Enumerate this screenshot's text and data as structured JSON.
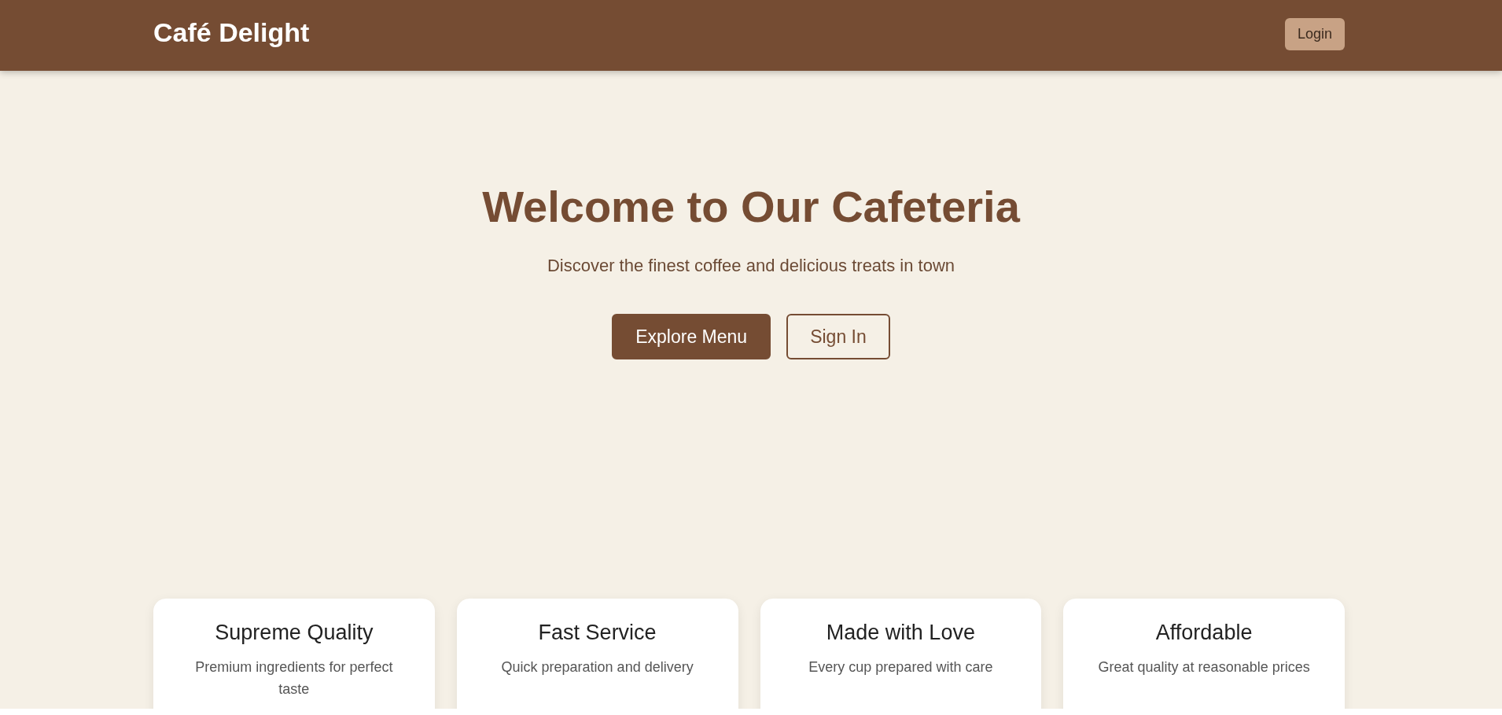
{
  "header": {
    "logo": "Café Delight",
    "login_button": "Login"
  },
  "hero": {
    "title": "Welcome to Our Cafeteria",
    "subtitle": "Discover the finest coffee and delicious treats in town",
    "buttons": [
      {
        "label": "Explore Menu",
        "kind": "primary"
      },
      {
        "label": "Sign In",
        "kind": "outline"
      }
    ]
  },
  "features": [
    {
      "title": "Supreme Quality",
      "text": "Premium ingredients for perfect taste"
    },
    {
      "title": "Fast Service",
      "text": "Quick preparation and delivery"
    },
    {
      "title": "Made with Love",
      "text": "Every cup prepared with care"
    },
    {
      "title": "Affordable",
      "text": "Great quality at reasonable prices"
    }
  ]
}
